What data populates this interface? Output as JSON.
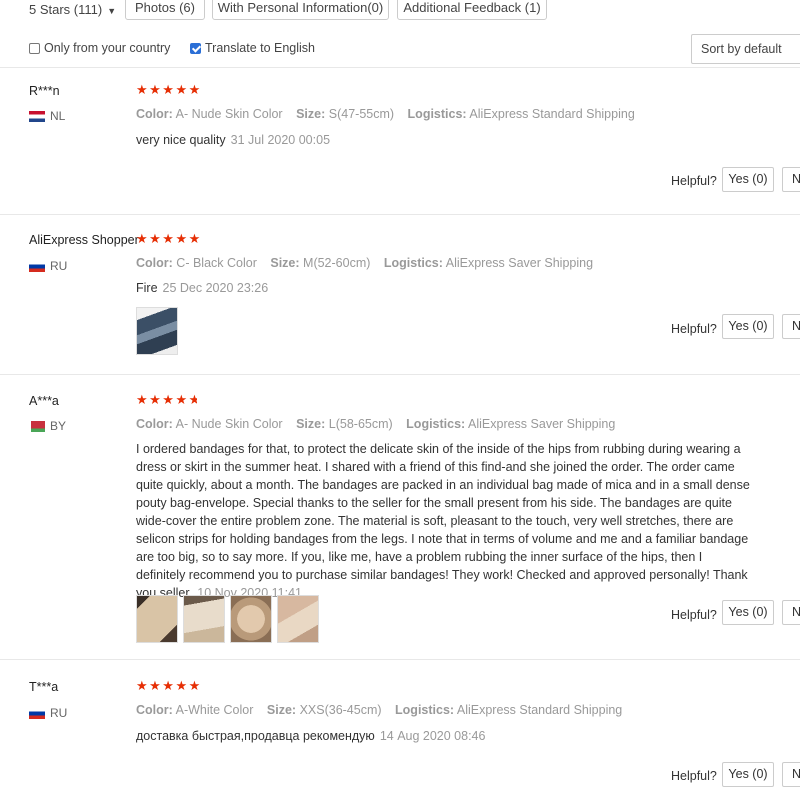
{
  "filters": {
    "stars_dropdown": "5 Stars (111)",
    "photos": "Photos (6)",
    "personal_info": "With Personal Information(0)",
    "additional_feedback": "Additional Feedback (1)"
  },
  "options": {
    "only_country": "Only from your country",
    "only_country_checked": false,
    "translate": "Translate to English",
    "translate_checked": true,
    "sort": "Sort by default"
  },
  "labels": {
    "color": "Color:",
    "size": "Size:",
    "logistics": "Logistics:",
    "helpful": "Helpful?",
    "yes": "Yes (0)",
    "no": "N"
  },
  "reviews": [
    {
      "user": "R***n",
      "country": "NL",
      "rating": 5,
      "color": "A- Nude Skin Color",
      "size": "S(47-55cm)",
      "logistics": "AliExpress Standard Shipping",
      "text": "very nice quality",
      "date": "31 Jul 2020 00:05",
      "photos": []
    },
    {
      "user": "AliExpress Shopper",
      "country": "RU",
      "rating": 5,
      "color": "C- Black Color",
      "size": "M(52-60cm)",
      "logistics": "AliExpress Saver Shipping",
      "text": "Fire",
      "date": "25 Dec 2020 23:26",
      "photos": [
        "photo-1"
      ]
    },
    {
      "user": "A***a",
      "country": "BY",
      "rating": 4.5,
      "color": "A- Nude Skin Color",
      "size": "L(58-65cm)",
      "logistics": "AliExpress Saver Shipping",
      "text": "I ordered bandages for that, to protect the delicate skin of the inside of the hips from rubbing during wearing a dress or skirt in the summer heat. I shared with a friend of this find-and she joined the order. The order came quite quickly, about a month. The bandages are packed in an individual bag made of mica and in a small dense pouty bag-envelope. Special thanks to the seller for the small present from his side. The bandages are quite wide-cover the entire problem zone. The material is soft, pleasant to the touch, very well stretches, there are selicon strips for holding bandages from the legs. I note that in terms of volume and me and a familiar bandage are too big, so to say more. If you, like me, have a problem rubbing the inner surface of the hips, then I definitely recommend you to purchase similar bandages! They work! Checked and approved personally! Thank you seller.",
      "date": "10 Nov 2020 11:41",
      "photos": [
        "photo-1",
        "photo-2",
        "photo-3",
        "photo-4"
      ]
    },
    {
      "user": "T***a",
      "country": "RU",
      "rating": 5,
      "color": "A-White Color",
      "size": "XXS(36-45cm)",
      "logistics": "AliExpress Standard Shipping",
      "text": "доставка быстрая,продавца рекомендую",
      "date": "14 Aug 2020 08:46",
      "photos": []
    }
  ],
  "colors": {
    "star": "#e62e04",
    "checkbox": "#2b6fd6"
  }
}
